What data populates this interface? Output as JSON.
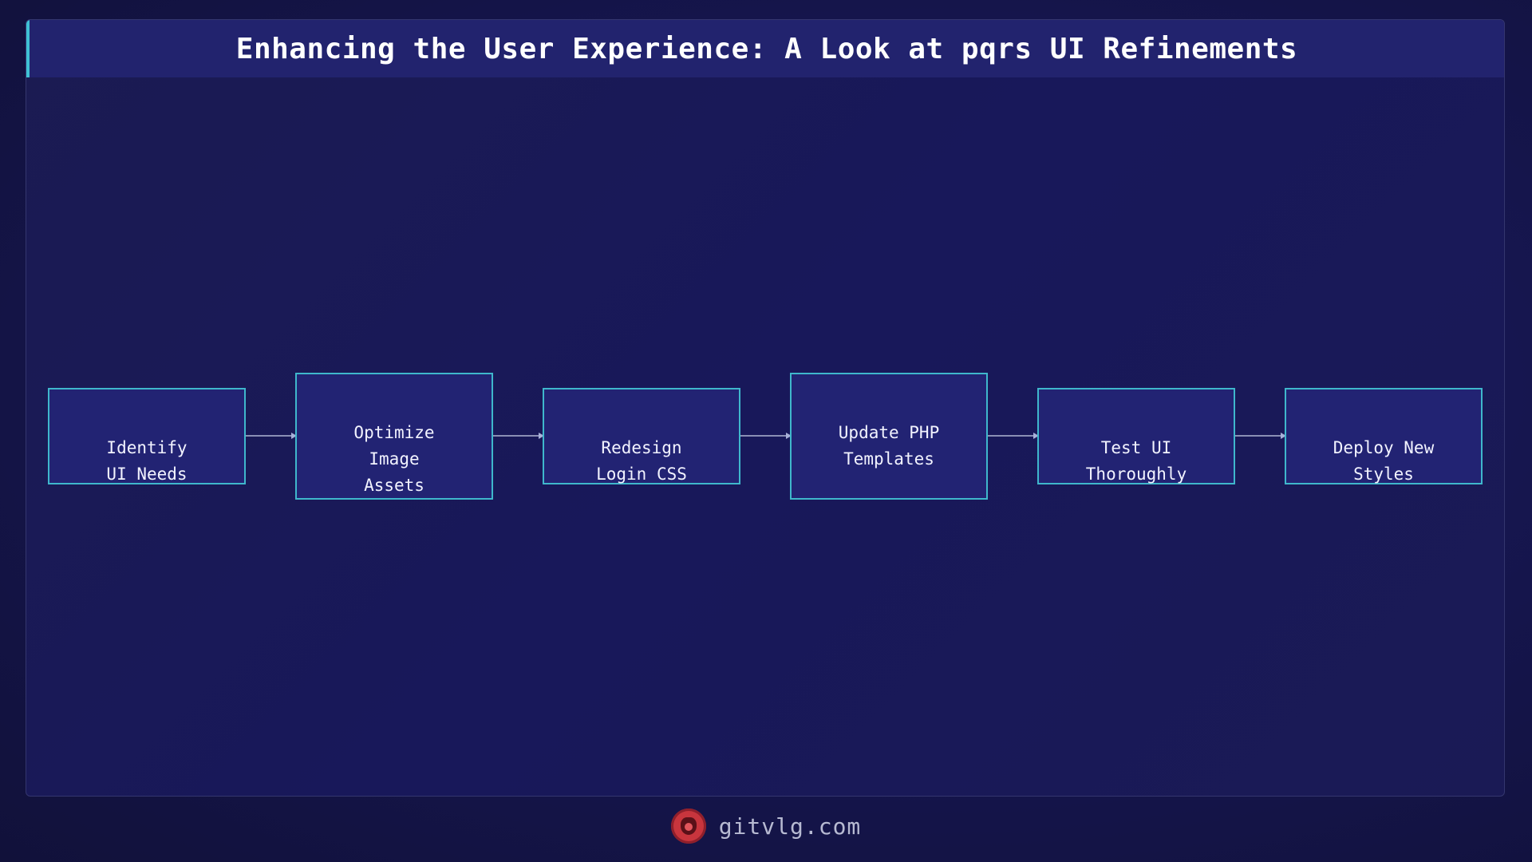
{
  "header": {
    "title": "Enhancing the User Experience: A Look at pqrs UI Refinements"
  },
  "flow": {
    "nodes": [
      {
        "label": "Identify\nUI Needs"
      },
      {
        "label": "Optimize\nImage\nAssets"
      },
      {
        "label": "Redesign\nLogin CSS"
      },
      {
        "label": "Update PHP\nTemplates"
      },
      {
        "label": "Test UI\nThoroughly"
      },
      {
        "label": "Deploy New\nStyles"
      }
    ]
  },
  "footer": {
    "site": "gitvlg.com",
    "logo_icon": "lion-head-icon"
  },
  "colors": {
    "background": "#12123a",
    "header": "#22236e",
    "accent": "#3fc1d4",
    "node_fill": "#222373",
    "node_border": "#3fb7cc",
    "logo": "#c8353d"
  }
}
